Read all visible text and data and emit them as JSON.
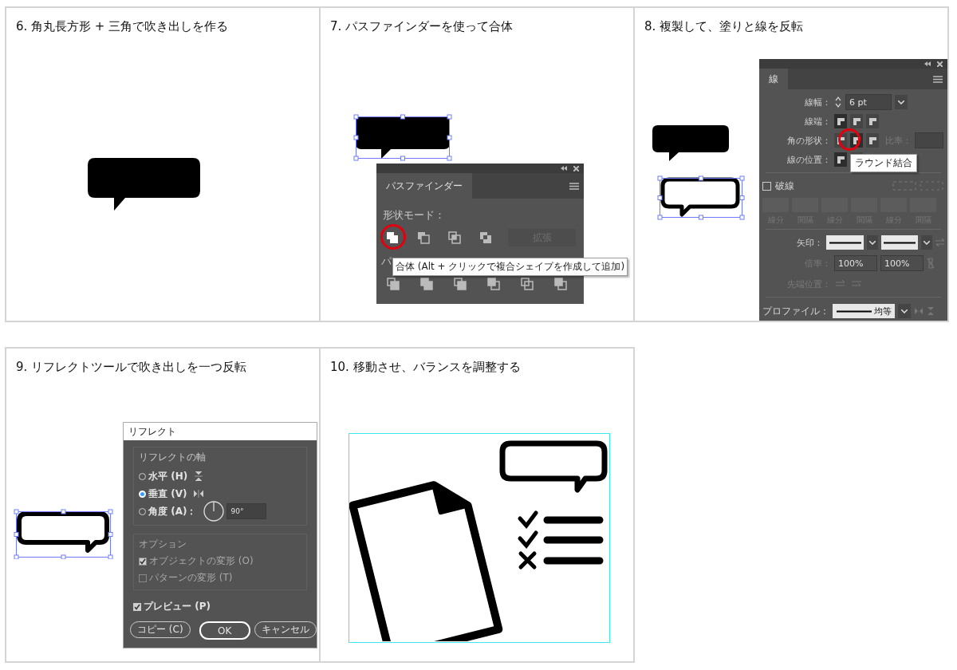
{
  "steps": [
    {
      "kind": "bubble",
      "title": "6. 角丸長方形 + 三角で吹き出しを作る"
    },
    {
      "kind": "pathfinder",
      "title": "7. パスファインダーを使って合体",
      "panel": {
        "tab": "パスファインダー",
        "shape_modes_label": "形状モード：",
        "expand_button": "拡張",
        "pathfinders_label": "パ",
        "tooltip": "合体 (Alt + クリックで複合シェイプを作成して追加)"
      }
    },
    {
      "kind": "stroke",
      "title": "8. 複製して、塗りと線を反転",
      "panel": {
        "tab": "線",
        "weight_label": "線幅：",
        "weight_value": "6 pt",
        "cap_label": "線端：",
        "corner_label": "角の形状：",
        "ratio_label": "比率：",
        "align_label": "線の位置：",
        "tooltip": "ラウンド結合",
        "dashed": {
          "label": "破線",
          "checked": false
        },
        "dash_labels": [
          "線分",
          "間隔",
          "線分",
          "間隔",
          "線分",
          "間隔"
        ],
        "arrow_label": "矢印：",
        "scale_label": "倍率：",
        "scale_values": [
          "100%",
          "100%"
        ],
        "tip_label": "先端位置：",
        "profile_label": "プロファイル：",
        "profile_value": "均等"
      }
    },
    {
      "kind": "reflect",
      "title": "9. リフレクトツールで吹き出しを一つ反転",
      "dialog": {
        "title": "リフレクト",
        "axis_group": "リフレクトの軸",
        "axes": [
          {
            "label": "水平 (H)",
            "selected": false
          },
          {
            "label": "垂直 (V)",
            "selected": true
          },
          {
            "label": "角度 (A)：",
            "selected": false
          }
        ],
        "angle": "90°",
        "options_group": "オプション",
        "options": [
          {
            "label": "オブジェクトの変形 (O)",
            "checked": true,
            "disabled": true
          },
          {
            "label": "パターンの変形 (T)",
            "checked": false,
            "disabled": true
          }
        ],
        "preview": {
          "label": "プレビュー (P)",
          "checked": true
        },
        "buttons": [
          {
            "label": "コピー (C)",
            "default": false
          },
          {
            "label": "OK",
            "default": true
          },
          {
            "label": "キャンセル",
            "default": false
          }
        ]
      }
    },
    {
      "kind": "result",
      "title": "10. 移動させ、バランスを調整する"
    }
  ]
}
